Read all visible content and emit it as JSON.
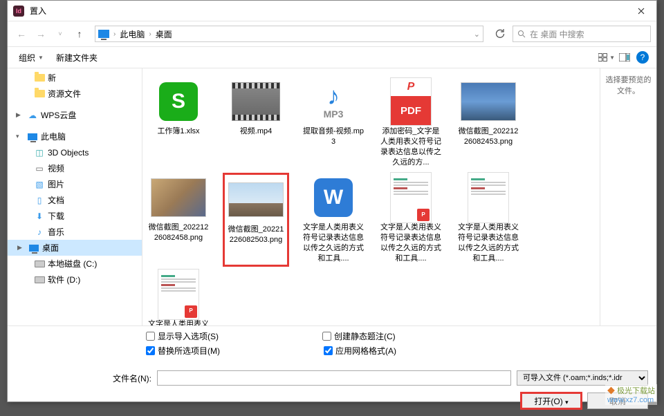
{
  "title": "置入",
  "breadcrumb": {
    "root": "此电脑",
    "current": "桌面"
  },
  "search_placeholder": "在 桌面 中搜索",
  "toolbar": {
    "organize": "组织",
    "newfolder": "新建文件夹"
  },
  "sidebar": {
    "new": "新",
    "resources": "资源文件",
    "wps": "WPS云盘",
    "thispc": "此电脑",
    "objects3d": "3D Objects",
    "videos": "视频",
    "pictures": "图片",
    "documents": "文档",
    "downloads": "下载",
    "music": "音乐",
    "desktop": "桌面",
    "diskc": "本地磁盘 (C:)",
    "diskd": "软件 (D:)"
  },
  "files": {
    "f0": "工作簿1.xlsx",
    "f1": "视频.mp4",
    "f2": "提取音频-视频.mp3",
    "f3": "添加密码_文字是人类用表义符号记录表达信息以传之久远的方...",
    "f4": "微信截图_20221226082453.png",
    "f5": "微信截图_20221226082458.png",
    "f6": "微信截图_20221226082503.png",
    "f7": "文字是人类用表义符号记录表达信息以传之久远的方式和工具....",
    "f8": "文字是人类用表义符号记录表达信息以传之久远的方式和工具....",
    "f9": "文字是人类用表义符号记录表达信息以传之久远的方式和工具....",
    "f10": "文字是人类用表义符号记录表达信息以传之久远的方式和工具...."
  },
  "preview_hint": "选择要预览的文件。",
  "options": {
    "show_import": "显示导入选项(S)",
    "create_static": "创建静态题注(C)",
    "replace_sel": "替换所选项目(M)",
    "apply_grid": "应用网格格式(A)"
  },
  "filename_label": "文件名(N):",
  "filter": "可导入文件 (*.oam;*.inds;*.idr",
  "open": "打开(O)",
  "cancel": "取消",
  "mp3": "MP3",
  "pdf": "PDF",
  "watermark": "极光下载站",
  "watermark_url": "www.xz7.com"
}
